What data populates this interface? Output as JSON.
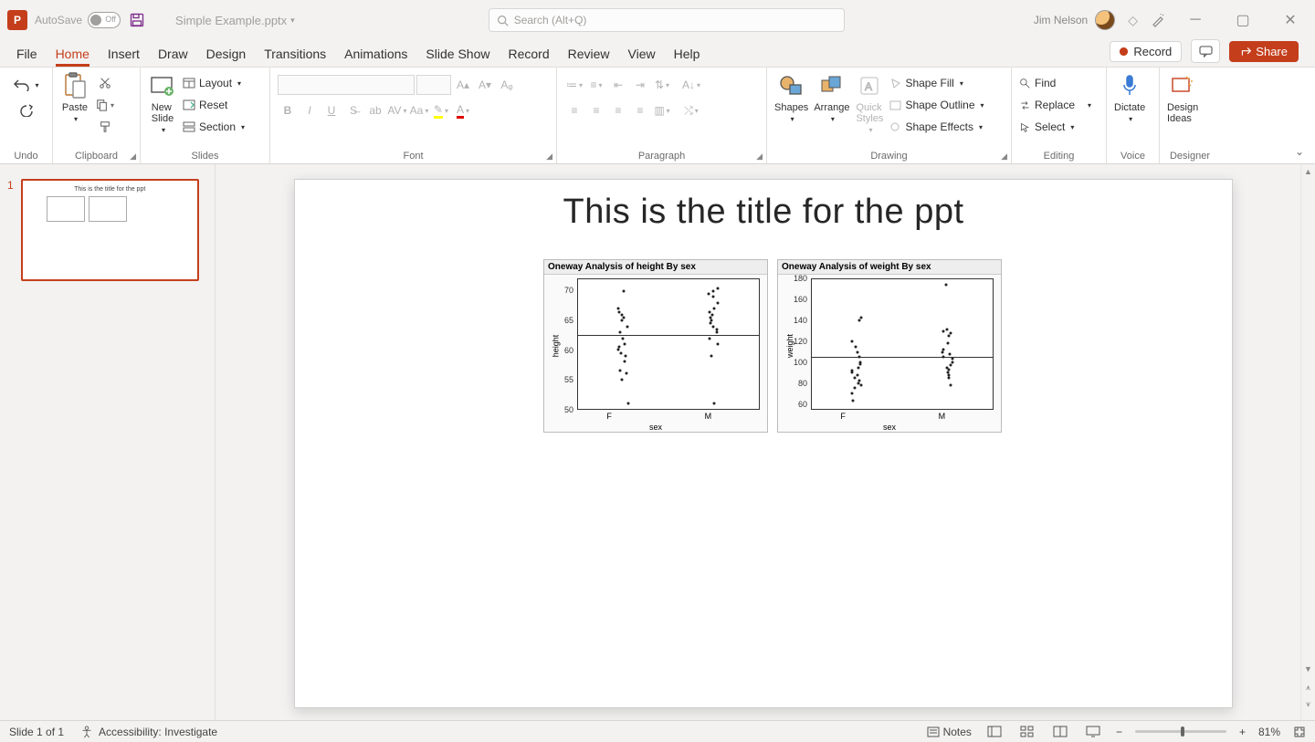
{
  "titlebar": {
    "autosave": "AutoSave",
    "autosave_state": "Off",
    "docname": "Simple Example.pptx",
    "search_placeholder": "Search (Alt+Q)",
    "user": "Jim Nelson"
  },
  "tabs": {
    "items": [
      "File",
      "Home",
      "Insert",
      "Draw",
      "Design",
      "Transitions",
      "Animations",
      "Slide Show",
      "Record",
      "Review",
      "View",
      "Help"
    ],
    "active": "Home",
    "record": "Record",
    "share": "Share"
  },
  "ribbon": {
    "undo": "Undo",
    "clipboard": {
      "paste": "Paste",
      "label": "Clipboard"
    },
    "slides": {
      "new_slide": "New\nSlide",
      "layout": "Layout",
      "reset": "Reset",
      "section": "Section",
      "label": "Slides"
    },
    "font": {
      "label": "Font"
    },
    "paragraph": {
      "label": "Paragraph"
    },
    "drawing": {
      "shapes": "Shapes",
      "arrange": "Arrange",
      "quick_styles": "Quick\nStyles",
      "fill": "Shape Fill",
      "outline": "Shape Outline",
      "effects": "Shape Effects",
      "label": "Drawing"
    },
    "editing": {
      "find": "Find",
      "replace": "Replace",
      "select": "Select",
      "label": "Editing"
    },
    "voice": {
      "dictate": "Dictate",
      "label": "Voice"
    },
    "designer": {
      "design_ideas": "Design\nIdeas",
      "label": "Designer"
    }
  },
  "thumb": {
    "index": "1",
    "title": "This is the title for the ppt"
  },
  "slide": {
    "title": "This is the title for the ppt"
  },
  "status": {
    "slide_info": "Slide 1 of 1",
    "accessibility": "Accessibility: Investigate",
    "notes": "Notes",
    "zoom": "81%"
  },
  "chart_data": [
    {
      "type": "scatter",
      "title": "Oneway Analysis of height By sex",
      "xlabel": "sex",
      "ylabel": "height",
      "ylim": [
        50,
        72
      ],
      "yticks": [
        50,
        55,
        60,
        65,
        70
      ],
      "categories": [
        "F",
        "M"
      ],
      "mean_line": 62.5,
      "series": [
        {
          "name": "F",
          "values": [
            51,
            55,
            56,
            56.5,
            58,
            59,
            59.5,
            60,
            60.5,
            61,
            62,
            63,
            64,
            65,
            65.5,
            66,
            66.5,
            67,
            70
          ]
        },
        {
          "name": "M",
          "values": [
            51,
            59,
            61,
            62,
            63,
            63.5,
            64,
            64.5,
            65,
            65.5,
            66,
            66.5,
            67,
            68,
            69,
            69.5,
            70,
            70.5
          ]
        }
      ]
    },
    {
      "type": "scatter",
      "title": "Oneway Analysis of weight By sex",
      "xlabel": "sex",
      "ylabel": "weight",
      "ylim": [
        55,
        180
      ],
      "yticks": [
        60,
        80,
        100,
        120,
        140,
        160,
        180
      ],
      "categories": [
        "F",
        "M"
      ],
      "mean_line": 105,
      "series": [
        {
          "name": "F",
          "values": [
            63,
            70,
            75,
            78,
            80,
            82,
            85,
            88,
            90,
            92,
            95,
            98,
            100,
            105,
            110,
            115,
            120,
            140,
            143
          ]
        },
        {
          "name": "M",
          "values": [
            78,
            85,
            88,
            90,
            93,
            95,
            97,
            100,
            103,
            105,
            108,
            110,
            112,
            118,
            125,
            128,
            130,
            132,
            175
          ]
        }
      ]
    }
  ]
}
